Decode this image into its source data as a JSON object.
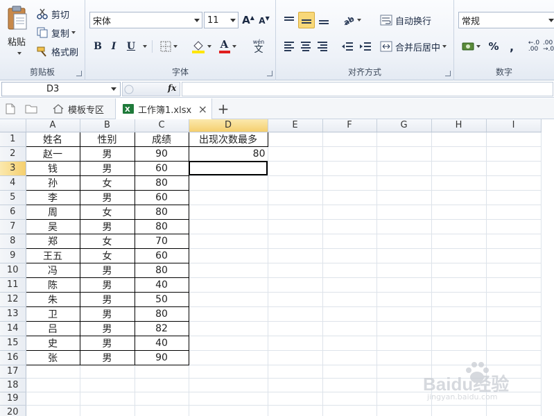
{
  "ribbon": {
    "clipboard": {
      "paste": "粘贴",
      "cut": "剪切",
      "copy": "复制",
      "format_painter": "格式刷",
      "label": "剪贴板"
    },
    "font": {
      "name": "宋体",
      "size": "11",
      "bold": "B",
      "italic": "I",
      "underline": "U",
      "font_color_letter": "A",
      "phonetic": "wén",
      "label": "字体",
      "fill_color": "#ffe600",
      "font_color": "#e01e1e"
    },
    "alignment": {
      "wrap_text": "自动换行",
      "merge_center": "合并后居中",
      "label": "对齐方式"
    },
    "number": {
      "format": "常规",
      "percent": "%",
      "comma": ",",
      "label": "数字"
    }
  },
  "formula_bar": {
    "name_box": "D3",
    "fx": "fx",
    "value": ""
  },
  "tabs": {
    "template_zone": "模板专区",
    "workbook": "工作簿1.xlsx",
    "close": "×",
    "add": "+"
  },
  "sheet": {
    "columns": [
      "A",
      "B",
      "C",
      "D",
      "E",
      "F",
      "G",
      "H",
      "I"
    ],
    "selected_column": "D",
    "selected_row": 3,
    "header": [
      "姓名",
      "性别",
      "成绩",
      "出现次数最多"
    ],
    "result": "80",
    "rows": [
      [
        "赵一",
        "男",
        "90"
      ],
      [
        "钱",
        "男",
        "60"
      ],
      [
        "孙",
        "女",
        "80"
      ],
      [
        "李",
        "男",
        "60"
      ],
      [
        "周",
        "女",
        "80"
      ],
      [
        "吴",
        "男",
        "80"
      ],
      [
        "郑",
        "女",
        "70"
      ],
      [
        "王五",
        "女",
        "60"
      ],
      [
        "冯",
        "男",
        "80"
      ],
      [
        "陈",
        "男",
        "40"
      ],
      [
        "朱",
        "男",
        "50"
      ],
      [
        "卫",
        "男",
        "80"
      ],
      [
        "吕",
        "男",
        "82"
      ],
      [
        "史",
        "男",
        "40"
      ],
      [
        "张",
        "男",
        "90"
      ]
    ],
    "row_numbers": [
      "1",
      "2",
      "3",
      "4",
      "5",
      "6",
      "7",
      "8",
      "9",
      "10",
      "11",
      "12",
      "13",
      "14",
      "15",
      "16",
      "17",
      "18",
      "19",
      "20",
      "21"
    ]
  },
  "watermark": {
    "brand": "Baidu经验",
    "url": "jingyan.baidu.com"
  }
}
